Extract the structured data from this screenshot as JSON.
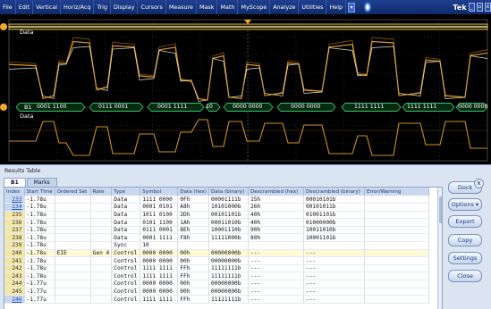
{
  "menubar": {
    "items": [
      "File",
      "Edit",
      "Vertical",
      "Horiz/Acq",
      "Trig",
      "Display",
      "Cursors",
      "Measure",
      "Mask",
      "Math",
      "MyScope",
      "Analyze",
      "Utilities",
      "Help"
    ],
    "brand": "Tek",
    "window_buttons": [
      "_",
      "▫",
      "x"
    ]
  },
  "scope": {
    "channel_top_label": "Data",
    "bus_label": "B1",
    "bus_data_label": "Data",
    "bus_segments": [
      {
        "text": "0001 1100"
      },
      {
        "text": "0111 0001"
      },
      {
        "text": "0001 1111"
      },
      {
        "text": "10"
      },
      {
        "text": "0000 0000"
      },
      {
        "text": "0000 0000"
      },
      {
        "text": "1111 1111"
      },
      {
        "text": "1111 1111"
      },
      {
        "text": "0000 0000"
      }
    ],
    "colors": {
      "bus": "#3fbf6a",
      "trace": "#f0a92c",
      "trace_hi": "#fff8e0",
      "grid": "#3a3a3a"
    }
  },
  "results": {
    "title": "Results Table",
    "tabs": [
      "B1",
      "Marks"
    ],
    "columns": [
      "Index",
      "Start Time",
      "Ordered Set",
      "Rate",
      "Type",
      "Symbol",
      "Data (hex)",
      "Data (binary)",
      "Descrambled (hex)",
      "Descrambled (binary)",
      "Error/Warning"
    ],
    "rows": [
      {
        "index": "233",
        "start": "-1.78u",
        "oset": "",
        "rate": "",
        "type": "Data",
        "symbol": "1111 0000",
        "hex": "0Fh",
        "bin": "00001111b",
        "dhex": "15h",
        "dbin": "00010101b",
        "err": "",
        "sel": true
      },
      {
        "index": "234",
        "start": "-1.78u",
        "oset": "",
        "rate": "",
        "type": "Data",
        "symbol": "0001 0101",
        "hex": "A8h",
        "bin": "10101000b",
        "dhex": "26h",
        "dbin": "00101011b",
        "err": "",
        "sel": true
      },
      {
        "index": "235",
        "start": "-1.78u",
        "oset": "",
        "rate": "",
        "type": "Data",
        "symbol": "1011 0100",
        "hex": "2Dh",
        "bin": "00101101b",
        "dhex": "40h",
        "dbin": "01001101b",
        "err": ""
      },
      {
        "index": "236",
        "start": "-1.78u",
        "oset": "",
        "rate": "",
        "type": "Data",
        "symbol": "0101 1100",
        "hex": "1Ah",
        "bin": "00011010b",
        "dhex": "40h",
        "dbin": "01000000b",
        "err": ""
      },
      {
        "index": "237",
        "start": "-1.78u",
        "oset": "",
        "rate": "",
        "type": "Data",
        "symbol": "0111 0001",
        "hex": "8Eh",
        "bin": "10001110b",
        "dhex": "90h",
        "dbin": "10011010b",
        "err": ""
      },
      {
        "index": "238",
        "start": "-1.78u",
        "oset": "",
        "rate": "",
        "type": "Data",
        "symbol": "0001 1111",
        "hex": "F8h",
        "bin": "11111000b",
        "dhex": "80h",
        "dbin": "10001101b",
        "err": ""
      },
      {
        "index": "239",
        "start": "-1.78u",
        "oset": "",
        "rate": "",
        "type": "Sync",
        "symbol": "10",
        "hex": "",
        "bin": "",
        "dhex": "",
        "dbin": "",
        "err": ""
      },
      {
        "index": "240",
        "start": "-1.78u",
        "oset": "EIE",
        "rate": "Gen 4",
        "type": "Control",
        "symbol": "0000 0000",
        "hex": "00h",
        "bin": "00000000b",
        "dhex": "---",
        "dbin": "---",
        "err": "",
        "hl": true
      },
      {
        "index": "241",
        "start": "-1.78u",
        "oset": "",
        "rate": "",
        "type": "Control",
        "symbol": "0000 0000",
        "hex": "00h",
        "bin": "00000000b",
        "dhex": "---",
        "dbin": "---",
        "err": ""
      },
      {
        "index": "242",
        "start": "-1.78u",
        "oset": "",
        "rate": "",
        "type": "Control",
        "symbol": "1111 1111",
        "hex": "FFh",
        "bin": "11111111b",
        "dhex": "---",
        "dbin": "---",
        "err": ""
      },
      {
        "index": "243",
        "start": "-1.78u",
        "oset": "",
        "rate": "",
        "type": "Control",
        "symbol": "1111 1111",
        "hex": "FFh",
        "bin": "11111111b",
        "dhex": "---",
        "dbin": "---",
        "err": ""
      },
      {
        "index": "244",
        "start": "-1.77u",
        "oset": "",
        "rate": "",
        "type": "Control",
        "symbol": "0000 0000",
        "hex": "00h",
        "bin": "00000000b",
        "dhex": "---",
        "dbin": "---",
        "err": ""
      },
      {
        "index": "245",
        "start": "-1.77u",
        "oset": "",
        "rate": "",
        "type": "Control",
        "symbol": "0000 0000",
        "hex": "00h",
        "bin": "00000000b",
        "dhex": "---",
        "dbin": "---",
        "err": ""
      },
      {
        "index": "246",
        "start": "-1.77u",
        "oset": "",
        "rate": "",
        "type": "Control",
        "symbol": "1111 1111",
        "hex": "FFh",
        "bin": "11111111b",
        "dhex": "---",
        "dbin": "---",
        "err": "",
        "sel": true
      }
    ],
    "buttons": [
      "Dock",
      "Options ▾",
      "Export",
      "Copy",
      "Settings",
      "Close"
    ],
    "close_label": "x"
  }
}
